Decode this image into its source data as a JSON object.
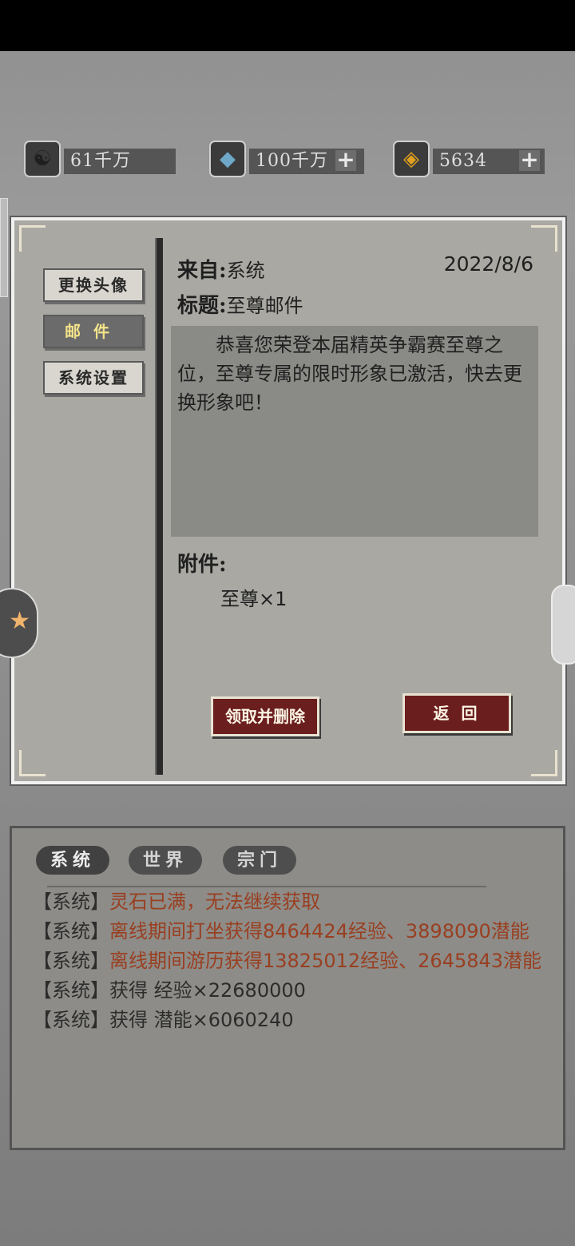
{
  "resources": [
    {
      "icon": "yin-yang-icon",
      "value": "61千万",
      "has_plus": false
    },
    {
      "icon": "crystal-icon",
      "value": "100千万",
      "has_plus": true
    },
    {
      "icon": "gold-gem-icon",
      "value": "5634",
      "has_plus": true
    }
  ],
  "sidebar": {
    "items": [
      {
        "label": "更换头像",
        "active": false
      },
      {
        "label": "邮件",
        "active": true
      },
      {
        "label": "系统设置",
        "active": false
      }
    ]
  },
  "mail": {
    "from_label": "来自:",
    "from_value": "系统",
    "date": "2022/8/6",
    "title_label": "标题:",
    "title_value": "至尊邮件",
    "body": "恭喜您荣登本届精英争霸赛至尊之位，至尊专属的限时形象已激活，快去更换形象吧！",
    "attachment_label": "附件:",
    "attachment_item": "至尊×1",
    "claim_button": "领取并删除",
    "back_button": "返 回"
  },
  "chat": {
    "tabs": [
      "系统",
      "世界",
      "宗门"
    ],
    "active_tab": 0,
    "messages": [
      {
        "prefix": "【系统】",
        "text": "灵石已满，无法继续获取",
        "highlight": true
      },
      {
        "prefix": "【系统】",
        "text": "离线期间打坐获得8464424经验、3898090潜能",
        "highlight": true
      },
      {
        "prefix": "【系统】",
        "text": "离线期间游历获得13825012经验、2645843潜能",
        "highlight": true
      },
      {
        "prefix": "【系统】",
        "text": "获得 经验×22680000",
        "highlight": false
      },
      {
        "prefix": "【系统】",
        "text": "获得 潜能×6060240",
        "highlight": false
      }
    ]
  },
  "colors": {
    "panel": "#a9a8a3",
    "button_red": "#6b1e1e",
    "highlight_text": "#9a3d1e",
    "active_tab_text": "#f3e28a"
  }
}
